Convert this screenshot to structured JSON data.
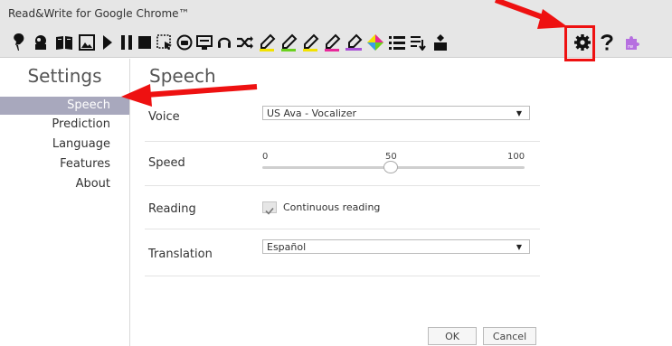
{
  "window": {
    "title": "Read&Write for Google Chrome™"
  },
  "toolbar": {
    "icons": [
      "check-it-icon",
      "word-prediction-icon",
      "dictionary-icon",
      "picture-dictionary-icon",
      "play-icon",
      "pause-icon",
      "stop-icon",
      "screenshot-reader-icon",
      "audio-maker-icon",
      "web-search-icon",
      "practice-reading-aloud-icon",
      "simplify-icon",
      "highlight-yellow-icon",
      "highlight-green-icon",
      "highlight-yellow2-icon",
      "highlight-pink-icon",
      "clear-highlights-icon",
      "collect-highlights-icon",
      "vocabulary-list-icon",
      "translator-icon",
      "voice-note-icon",
      "settings-icon",
      "help-icon",
      "extension-icon"
    ],
    "colors": {
      "yellow": "#f2e200",
      "green": "#6ad11f",
      "yellow2": "#f2e200",
      "pink": "#e8289a",
      "purple": "#a84fd6",
      "settings_box": "#ff0000"
    }
  },
  "sidebar": {
    "heading": "Settings",
    "items": [
      {
        "label": "Speech",
        "active": true
      },
      {
        "label": "Prediction",
        "active": false
      },
      {
        "label": "Language",
        "active": false
      },
      {
        "label": "Features",
        "active": false
      },
      {
        "label": "About",
        "active": false
      }
    ]
  },
  "main": {
    "title": "Speech",
    "voice": {
      "label": "Voice",
      "value": "US Ava - Vocalizer"
    },
    "speed": {
      "label": "Speed",
      "min": "0",
      "mid": "50",
      "max": "100",
      "value": 50
    },
    "reading": {
      "label": "Reading",
      "checkbox_label": "Continuous reading",
      "checked": true
    },
    "translation": {
      "label": "Translation",
      "value": "Español"
    }
  },
  "buttons": {
    "ok": "OK",
    "cancel": "Cancel"
  },
  "annotations": {
    "arrow_color": "#ee1111"
  }
}
